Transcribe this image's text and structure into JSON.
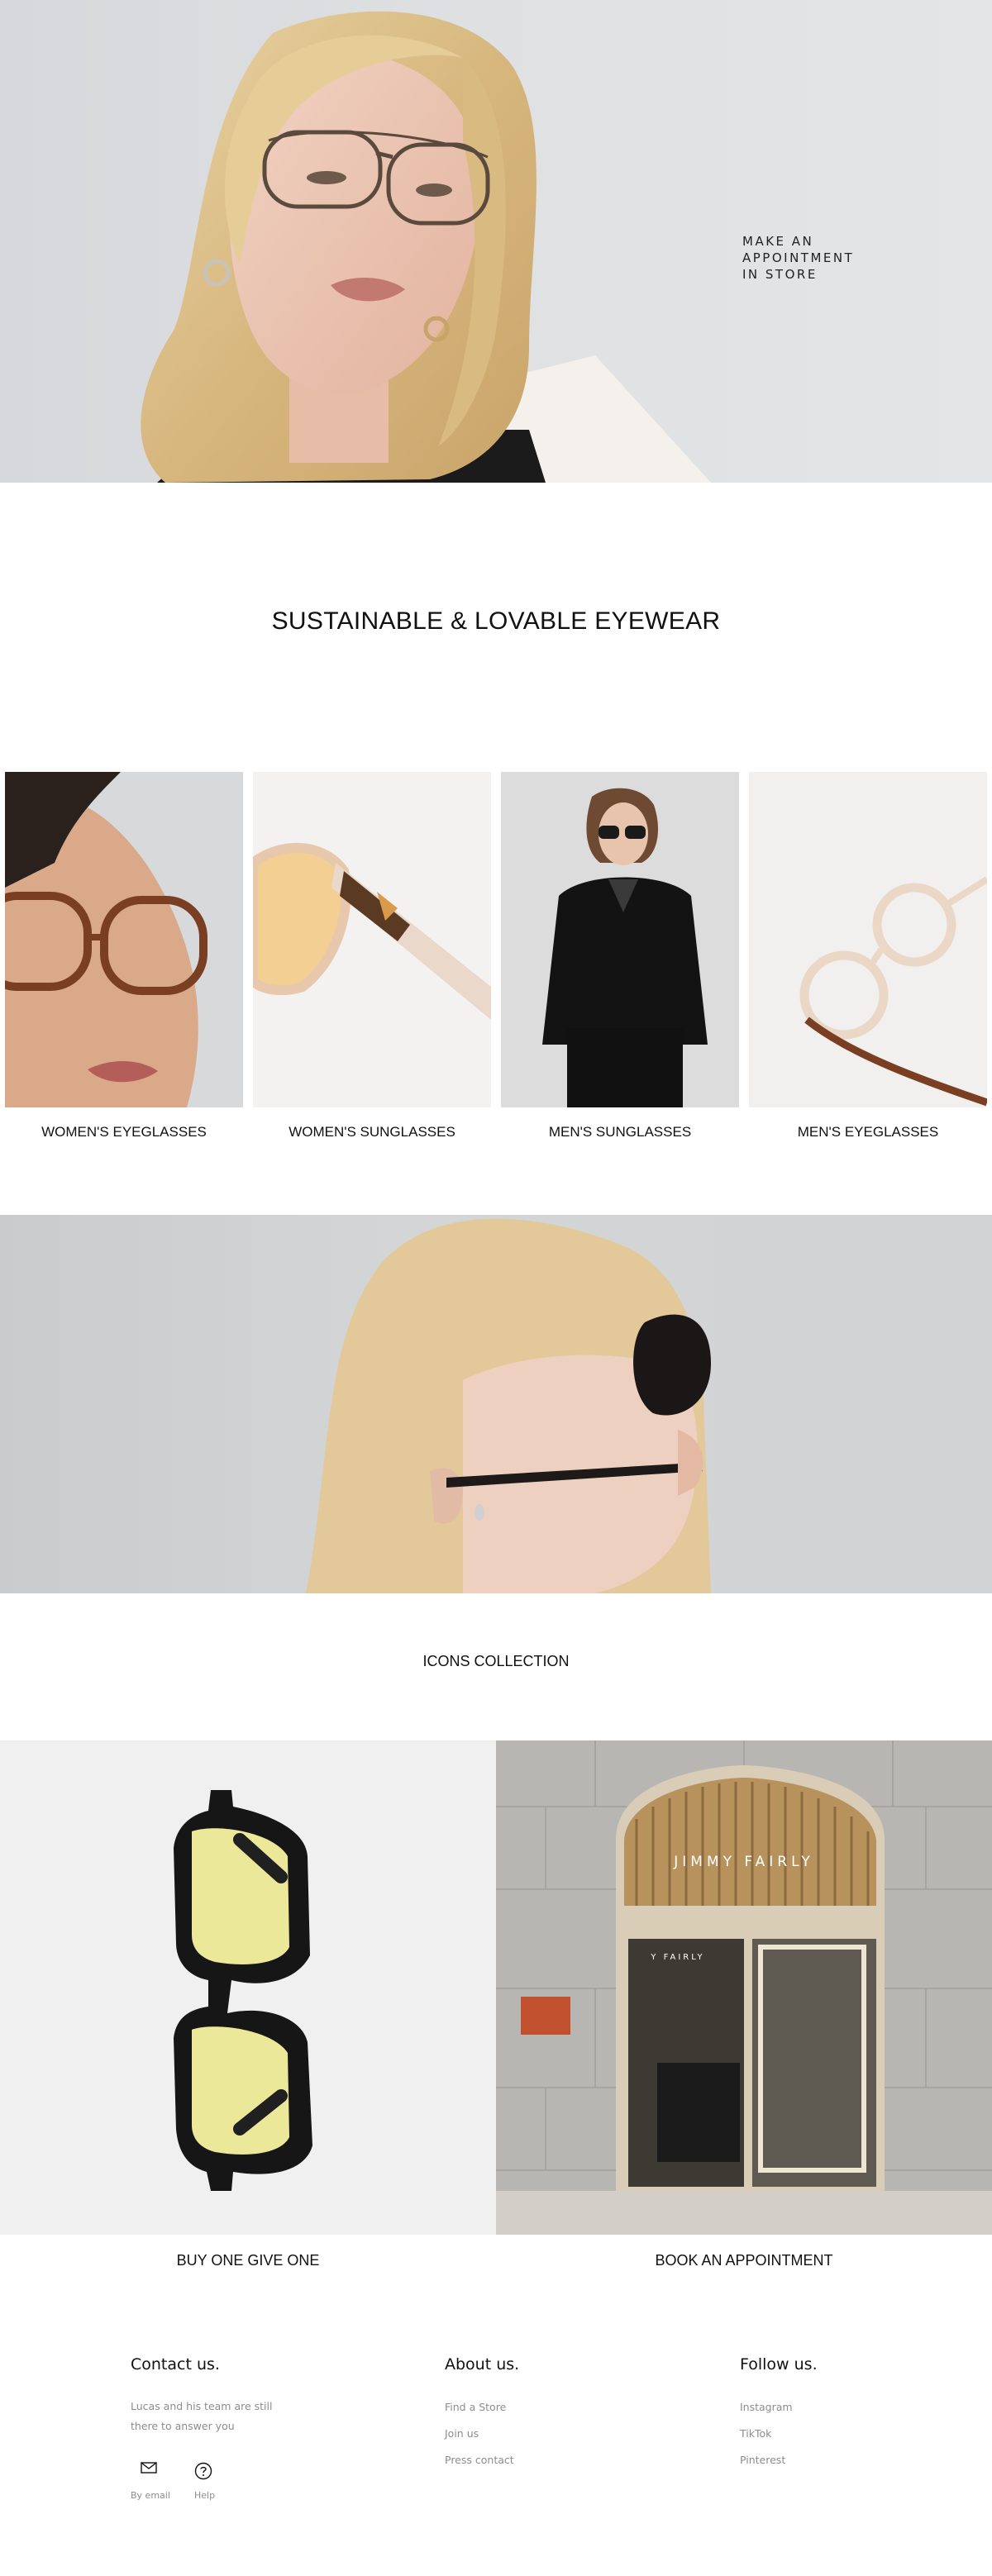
{
  "hero": {
    "cta_label": "MAKE AN APPOINTMENT IN STORE",
    "cta_line1": "MAKE AN",
    "cta_line2": "APPOINTMENT",
    "cta_line3": "IN STORE"
  },
  "tagline": "SUSTAINABLE & LOVABLE EYEWEAR",
  "categories": [
    {
      "label": "WOMEN'S EYEGLASSES"
    },
    {
      "label": "WOMEN'S SUNGLASSES"
    },
    {
      "label": "MEN'S SUNGLASSES"
    },
    {
      "label": "MEN'S EYEGLASSES"
    }
  ],
  "icons_collection": {
    "title": "ICONS COLLECTION"
  },
  "promo_tiles": [
    {
      "label": "BUY ONE GIVE ONE"
    },
    {
      "label": "BOOK AN APPOINTMENT",
      "store_sign": "JIMMY FAIRLY",
      "store_sign_small": "Y FAIRLY"
    }
  ],
  "footer": {
    "contact": {
      "title": "Contact us.",
      "text_line1": "Lucas and his team are still",
      "text_line2": "there to answer you",
      "email_label": "By email",
      "help_label": "Help",
      "email_icon": "envelope-icon",
      "help_icon": "question-circle-icon"
    },
    "about": {
      "title": "About us.",
      "links": [
        "Find a Store",
        "Join us",
        "Press contact"
      ]
    },
    "follow": {
      "title": "Follow us.",
      "links": [
        "Instagram",
        "TikTok",
        "Pinterest"
      ]
    }
  },
  "colors": {
    "background": "#ffffff",
    "text": "#111111",
    "muted": "#8c8c8c",
    "hero_bg": "#dcdee0"
  }
}
